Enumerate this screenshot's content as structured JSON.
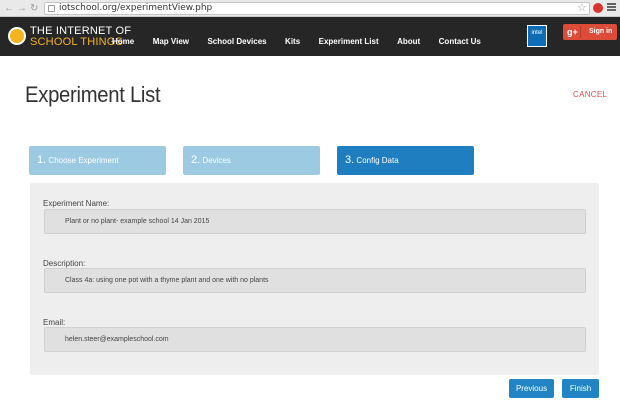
{
  "browser": {
    "url": "iotschool.org/experimentView.php",
    "back_icon": "left-arrow",
    "forward_icon": "right-arrow",
    "reload_icon": "reload-arrow"
  },
  "site": {
    "logo_line1": "THE INTERNET OF",
    "logo_line2": "SCHOOL THINGS",
    "nav": [
      "Home",
      "Map View",
      "School Devices",
      "Kits",
      "Experiment List",
      "About",
      "Contact Us"
    ],
    "intel_label": "intel",
    "signin_icon": "g+",
    "signin_label": "Sign in"
  },
  "page": {
    "title": "Experiment List",
    "cancel": "CANCEL"
  },
  "steps": [
    {
      "num": "1.",
      "label": "Choose Experiment",
      "active": false
    },
    {
      "num": "2.",
      "label": "Devices",
      "active": false
    },
    {
      "num": "3.",
      "label": "Config Data",
      "active": true
    }
  ],
  "form": {
    "name_label": "Experiment Name:",
    "name_value": "Plant or no plant- example school 14 Jan 2015",
    "desc_label": "Description:",
    "desc_value": "Class 4a: using one pot with a thyme plant and one with no plants",
    "email_label": "Email:",
    "email_value": "helen.steer@exampleschool.com"
  },
  "buttons": {
    "previous": "Previous",
    "finish": "Finish"
  },
  "colors": {
    "nav_bg": "#262626",
    "step_inactive": "#9ccae3",
    "step_active": "#1e7ebf",
    "button": "#2184c4",
    "cancel": "#d9534f"
  }
}
